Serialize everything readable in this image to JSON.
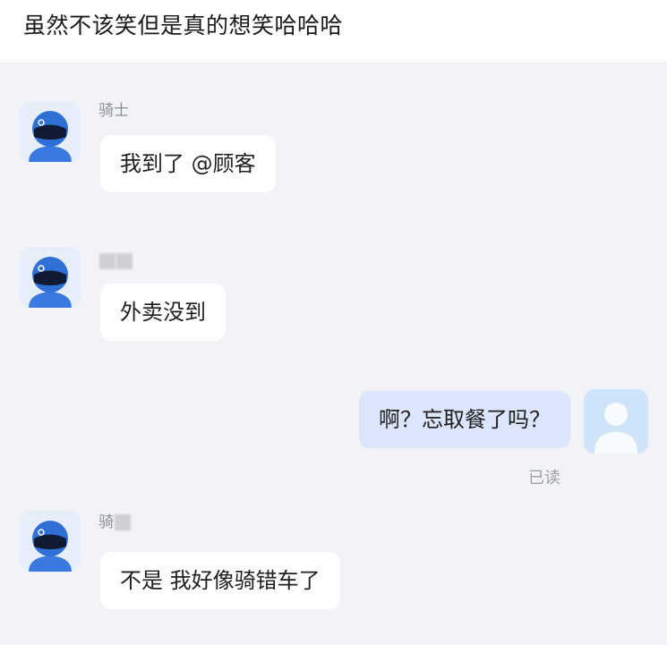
{
  "post": {
    "title": "虽然不该笑但是真的想笑哈哈哈"
  },
  "messages": [
    {
      "sender": "骑士",
      "text": "我到了 @顾客"
    },
    {
      "sender": "",
      "text": "外卖没到"
    },
    {
      "sender": "self",
      "text": "啊？忘取餐了吗？",
      "status": "已读"
    },
    {
      "sender": "骑",
      "text": "不是 我好像骑错车了"
    }
  ],
  "colors": {
    "chat_background": "#f2f3f7",
    "rider_helmet": "#2f6fd6",
    "self_bubble": "#dbe6fb"
  },
  "icons": {
    "rider_avatar": "rider-helmet-icon",
    "user_avatar": "default-user-icon"
  }
}
